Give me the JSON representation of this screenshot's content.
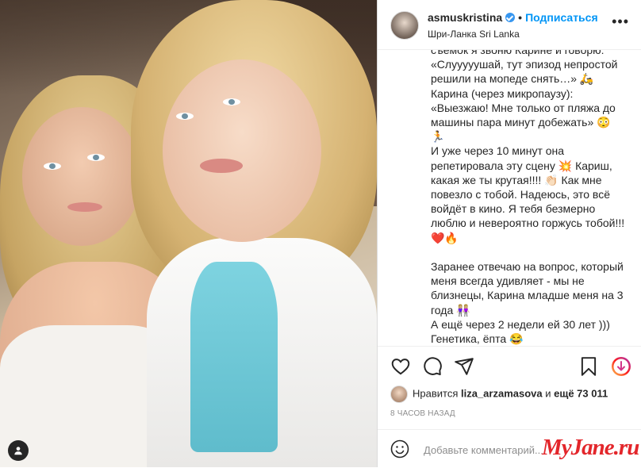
{
  "header": {
    "username": "asmuskristina",
    "separator": "•",
    "follow_label": "Подписаться",
    "location": "Шри-Ланка Sri Lanka",
    "more_label": "•••"
  },
  "caption": {
    "lines": [
      "съемок я звоню Карине и говорю:",
      "«Слууууушай, тут эпизод непростой решили на мопеде снять…» 🛵",
      "Карина (через микропаузу):",
      "«Выезжаю! Мне только от пляжа до машины пара минут добежать» 😳",
      "🏃",
      "И уже через 10 минут она репетировала эту сцену 💥 Кариш, какая же ты крутая!!!! 👏🏻 Как мне повезло с тобой. Надеюсь, это всё войдёт в кино. Я тебя безмерно люблю и невероятно горжусь тобой!!! ❤️🔥",
      "",
      "Заранее отвечаю на вопрос, который меня всегда удивляет - мы не близнецы, Карина младше меня на 3 года 👭🏼",
      "А ещё через 2 недели ей 30 лет )))",
      "Генетика, ёпта 😂"
    ]
  },
  "likes": {
    "prefix": "Нравится",
    "user": "liza_arzamasova",
    "middle": "и",
    "rest": "ещё 73 011"
  },
  "time": "8 часов назад",
  "comment": {
    "placeholder": "Добавьте комментарий..."
  },
  "watermark": "MyJane.ru",
  "colors": {
    "accent": "#0095f6",
    "verified": "#3897f0",
    "watermark": "#e3262b"
  },
  "icons": [
    "heart-icon",
    "comment-icon",
    "share-icon",
    "bookmark-icon",
    "scroll-down-icon",
    "emoji-icon",
    "user-tag-icon",
    "verified-icon"
  ]
}
